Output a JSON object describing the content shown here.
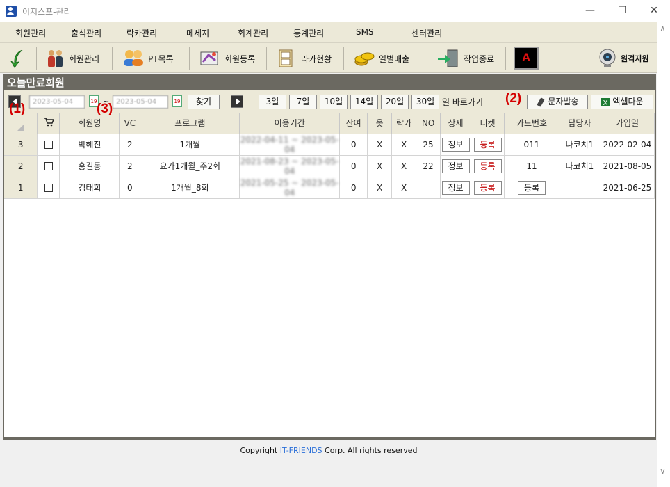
{
  "window": {
    "title": "이지스포-관리",
    "minimize": "—",
    "maximize": "☐",
    "close": "✕"
  },
  "menu": [
    "회원관리",
    "출석관리",
    "락카관리",
    "메세지",
    "회계관리",
    "통계관리",
    "SMS",
    "센터관리"
  ],
  "toolbar": {
    "member_mgmt": "회원관리",
    "pt_list": "PT목록",
    "member_reg": "회원등록",
    "locker_status": "라카현황",
    "daily_sales": "일별매출",
    "end_work": "작업종료",
    "a_label": "A",
    "remote": "원격지원"
  },
  "panel": {
    "title": "오늘만료회원"
  },
  "filter": {
    "date_from": "2023-05-04",
    "tilde": "~",
    "date_to": "2023-05-04",
    "find": "찾기",
    "quick": [
      "3일",
      "7일",
      "10일",
      "14일",
      "20일",
      "30일"
    ],
    "quick_suffix": "일 바로가기",
    "sms": "문자발송",
    "excel": "엑셀다운"
  },
  "annotations": {
    "a1": "(1)",
    "a2": "(2)",
    "a3": "(3)"
  },
  "table": {
    "headers": [
      "",
      "🛒",
      "회원명",
      "VC",
      "프로그램",
      "이용기간",
      "잔여",
      "옷",
      "락카",
      "NO",
      "상세",
      "티켓",
      "카드번호",
      "담당자",
      "가입일"
    ],
    "detail_label": "정보",
    "ticket_label": "등록",
    "rows": [
      {
        "num": "3",
        "name": "박혜진",
        "vc": "2",
        "program": "1개월",
        "period": "2022-04-11 ~ 2023-05-04",
        "remain": "0",
        "clothes": "X",
        "locker": "X",
        "no": "25",
        "card": "011",
        "card_btn": "",
        "manager": "나코치1",
        "joined": "2022-02-04"
      },
      {
        "num": "2",
        "name": "홍길동",
        "vc": "2",
        "program": "요가1개월_주2회",
        "period": "2021-08-23 ~ 2023-05-04",
        "remain": "0",
        "clothes": "X",
        "locker": "X",
        "no": "22",
        "card": "11",
        "card_btn": "",
        "manager": "나코치1",
        "joined": "2021-08-05"
      },
      {
        "num": "1",
        "name": "김태희",
        "vc": "0",
        "program": "1개월_8회",
        "period": "2021-05-25 ~ 2023-05-04",
        "remain": "0",
        "clothes": "X",
        "locker": "X",
        "no": "",
        "card": "",
        "card_btn": "등록",
        "manager": "",
        "joined": "2021-06-25"
      }
    ]
  },
  "footer": {
    "pre": "Copyright ",
    "brand": "IT-FRIENDS",
    "post": " Corp. All rights reserved"
  }
}
